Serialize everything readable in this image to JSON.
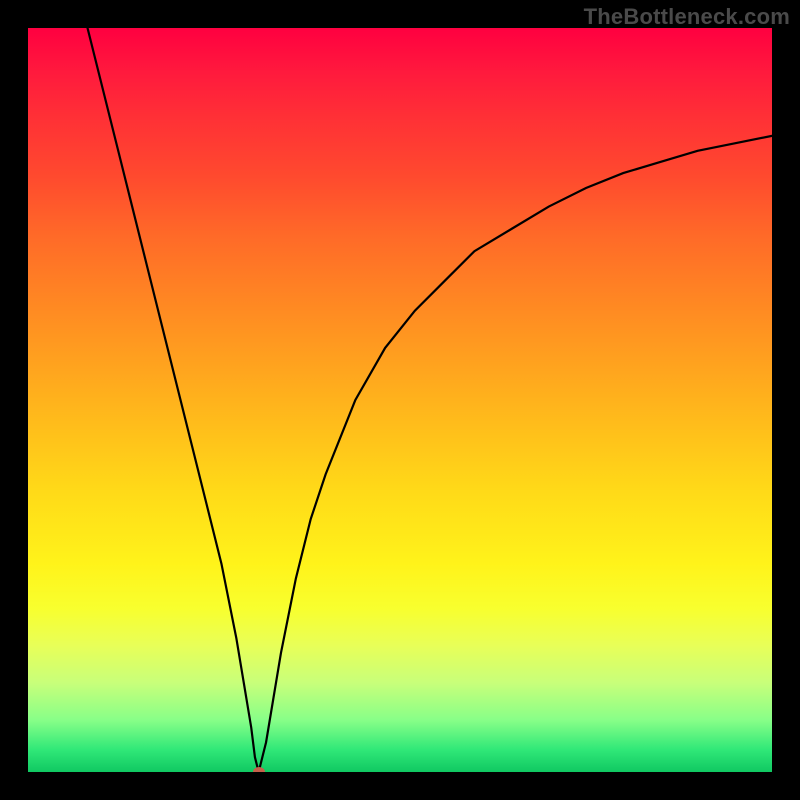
{
  "watermark": "TheBottleneck.com",
  "colors": {
    "frame": "#000000",
    "curve": "#000000",
    "marker": "#c6604a"
  },
  "chart_data": {
    "type": "line",
    "title": "",
    "xlabel": "",
    "ylabel": "",
    "xlim": [
      0,
      100
    ],
    "ylim": [
      0,
      100
    ],
    "grid": false,
    "legend": false,
    "annotations": [],
    "series": [
      {
        "name": "left-branch",
        "x": [
          8,
          10,
          12,
          14,
          16,
          18,
          20,
          22,
          24,
          26,
          28,
          29,
          30,
          30.5,
          31
        ],
        "y": [
          100,
          92,
          84,
          76,
          68,
          60,
          52,
          44,
          36,
          28,
          18,
          12,
          6,
          2,
          0
        ]
      },
      {
        "name": "right-branch",
        "x": [
          31,
          32,
          33,
          34,
          36,
          38,
          40,
          44,
          48,
          52,
          56,
          60,
          65,
          70,
          75,
          80,
          85,
          90,
          95,
          100
        ],
        "y": [
          0,
          4,
          10,
          16,
          26,
          34,
          40,
          50,
          57,
          62,
          66,
          70,
          73,
          76,
          78.5,
          80.5,
          82,
          83.5,
          84.5,
          85.5
        ]
      }
    ],
    "marker": {
      "x": 31,
      "y": 0
    }
  }
}
